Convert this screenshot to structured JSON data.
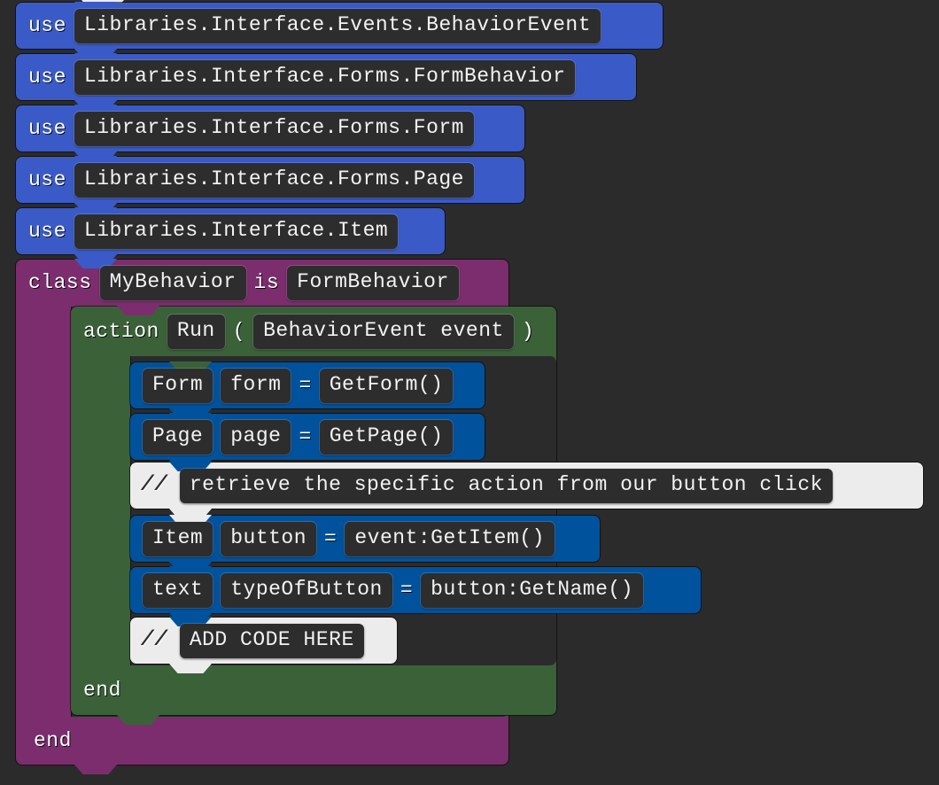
{
  "editor": {
    "name": "quorum-block-editor",
    "background_color": "#2b2b2b",
    "language": "Quorum"
  },
  "palette": {
    "use_block": "#3a5bc7",
    "assignment_block": "#00529c",
    "class_block": "#7b2d6e",
    "action_block": "#3b6139",
    "comment_block": "#ececec",
    "field_background": "#2d2d2d",
    "field_text": "#f2f2f2",
    "canvas": "#2b2b2b"
  },
  "blocks": {
    "use_statements": [
      {
        "keyword": "use",
        "value": "Libraries.Interface.Events.BehaviorEvent"
      },
      {
        "keyword": "use",
        "value": "Libraries.Interface.Forms.FormBehavior"
      },
      {
        "keyword": "use",
        "value": "Libraries.Interface.Forms.Form"
      },
      {
        "keyword": "use",
        "value": "Libraries.Interface.Forms.Page"
      },
      {
        "keyword": "use",
        "value": "Libraries.Interface.Item"
      }
    ],
    "class_block": {
      "keyword": "class",
      "name": "MyBehavior",
      "is_keyword": "is",
      "parent": "FormBehavior",
      "end_keyword": "end"
    },
    "action_block": {
      "keyword": "action",
      "name": "Run",
      "open_paren": "(",
      "parameters": "BehaviorEvent event",
      "close_paren": ")",
      "end_keyword": "end"
    },
    "body": [
      {
        "kind": "assignment",
        "type": "Form",
        "variable": "form",
        "operator": "=",
        "expression": "GetForm()"
      },
      {
        "kind": "assignment",
        "type": "Page",
        "variable": "page",
        "operator": "=",
        "expression": "GetPage()"
      },
      {
        "kind": "comment",
        "marker": "//",
        "text": "retrieve the specific action from our button click"
      },
      {
        "kind": "assignment",
        "type": "Item",
        "variable": "button",
        "operator": "=",
        "expression": "event:GetItem()"
      },
      {
        "kind": "assignment",
        "type": "text",
        "variable": "typeOfButton",
        "operator": "=",
        "expression": "button:GetName()"
      },
      {
        "kind": "comment",
        "marker": "//",
        "text": "ADD CODE HERE"
      }
    ]
  }
}
